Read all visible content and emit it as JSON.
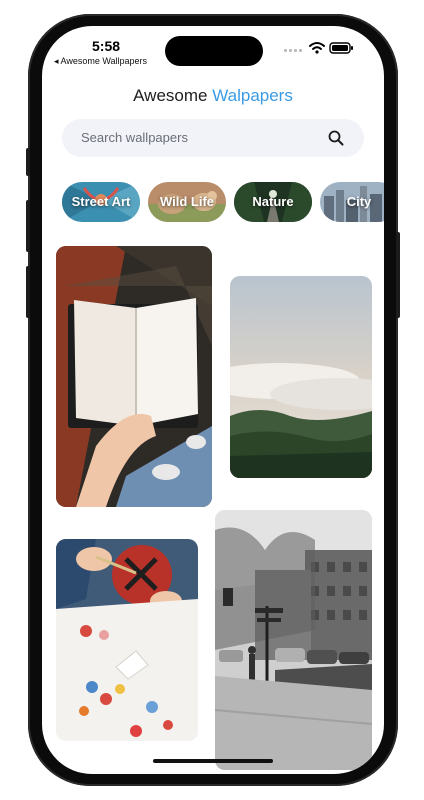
{
  "status": {
    "time": "5:58",
    "back_label": "◂ Awesome Wallpapers"
  },
  "header": {
    "title_primary": "Awesome",
    "title_accent": "Walpapers",
    "accent_color": "#3a9be5"
  },
  "search": {
    "placeholder": "Search wallpapers",
    "icon": "search-icon"
  },
  "categories": [
    {
      "label": "Street Art"
    },
    {
      "label": "Wild Life"
    },
    {
      "label": "Nature"
    },
    {
      "label": "City"
    }
  ],
  "wallpapers": [
    {
      "subject": "open-notebook"
    },
    {
      "subject": "fog-forest"
    },
    {
      "subject": "paint-palette"
    },
    {
      "subject": "city-street"
    }
  ]
}
